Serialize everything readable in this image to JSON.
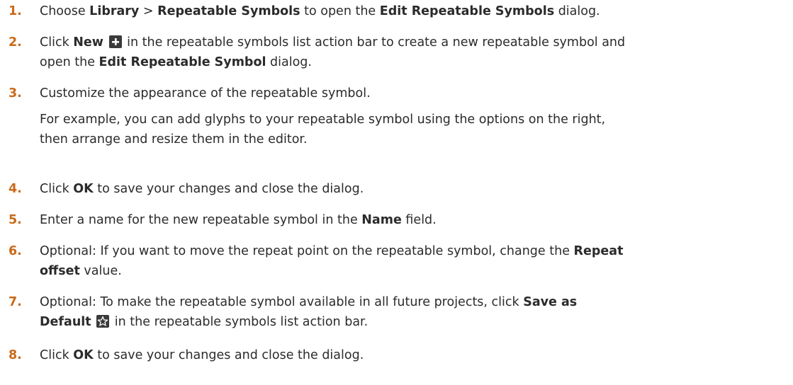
{
  "steps": [
    {
      "num": "1.",
      "lines": [
        [
          "Choose ",
          "Library",
          " > ",
          "Repeatable Symbols",
          " to open the ",
          "Edit Repeatable Symbols",
          " dialog."
        ]
      ]
    },
    {
      "num": "2.",
      "l1a": "Click ",
      "l1b": "New",
      "l1c": " in the repeatable symbols list action bar to create a new repeatable symbol and",
      "l2a": "open the ",
      "l2b": "Edit Repeatable Symbol",
      "l2c": " dialog.",
      "icon": "plus-icon"
    },
    {
      "num": "3.",
      "l1": "Customize the appearance of the repeatable symbol.",
      "l2": "For example, you can add glyphs to your repeatable symbol using the options on the right,",
      "l3": "then arrange and resize them in the editor."
    },
    {
      "num": "4.",
      "a": "Click ",
      "b": "OK",
      "c": " to save your changes and close the dialog."
    },
    {
      "num": "5.",
      "a": "Enter a name for the new repeatable symbol in the ",
      "b": "Name",
      "c": " field."
    },
    {
      "num": "6.",
      "l1a": "Optional: If you want to move the repeat point on the repeatable symbol, change the ",
      "l1b": "Repeat",
      "l2a": "offset",
      "l2b": " value."
    },
    {
      "num": "7.",
      "l1a": "Optional: To make the repeatable symbol available in all future projects, click ",
      "l1b": "Save as",
      "l2a": "Default",
      "l2b": " in the repeatable symbols list action bar.",
      "icon": "star-icon"
    },
    {
      "num": "8.",
      "a": "Click ",
      "b": "OK",
      "c": " to save your changes and close the dialog."
    }
  ]
}
